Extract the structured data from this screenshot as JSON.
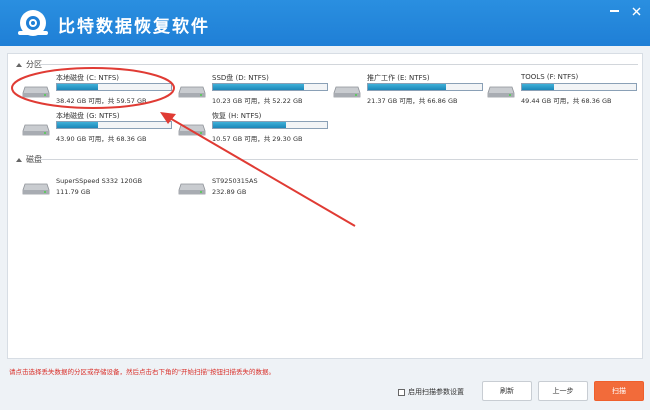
{
  "app": {
    "title": "比特数据恢复软件"
  },
  "sections": {
    "partitions_label": "分区",
    "disks_label": "磁盘"
  },
  "partitions": [
    {
      "name": "本地磁盘 (C: NTFS)",
      "size": "38.42 GB 可用，共 59.57 GB",
      "used_fraction": 0.36
    },
    {
      "name": "SSD盘 (D: NTFS)",
      "size": "10.23 GB 可用，共 52.22 GB",
      "used_fraction": 0.8
    },
    {
      "name": "推广工作 (E: NTFS)",
      "size": "21.37 GB 可用，共 66.86 GB",
      "used_fraction": 0.68
    },
    {
      "name": "TOOLS (F: NTFS)",
      "size": "49.44 GB 可用，共 68.36 GB",
      "used_fraction": 0.28
    },
    {
      "name": "本地磁盘 (G: NTFS)",
      "size": "43.90 GB 可用，共 68.36 GB",
      "used_fraction": 0.36
    },
    {
      "name": "恢复 (H: NTFS)",
      "size": "10.57 GB 可用，共 29.30 GB",
      "used_fraction": 0.64
    }
  ],
  "disks": [
    {
      "name": "SuperSSpeed S332 120GB",
      "size": "111.79 GB"
    },
    {
      "name": "ST9250315AS",
      "size": "232.89 GB"
    }
  ],
  "footer": {
    "hint": "请点击选择丢失数据的分区或存储设备，然后点击右下角的\"开始扫描\"按钮扫描丢失的数据。",
    "checkbox_label": "启用扫描参数设置",
    "refresh": "刷新",
    "prev": "上一步",
    "scan": "扫描"
  },
  "colors": {
    "titlebar": "#1f7fd6",
    "bar_fill": "#2196c9",
    "scan_button": "#f26b3a",
    "annotation": "#e03b34",
    "hint_text": "#d9302a"
  }
}
